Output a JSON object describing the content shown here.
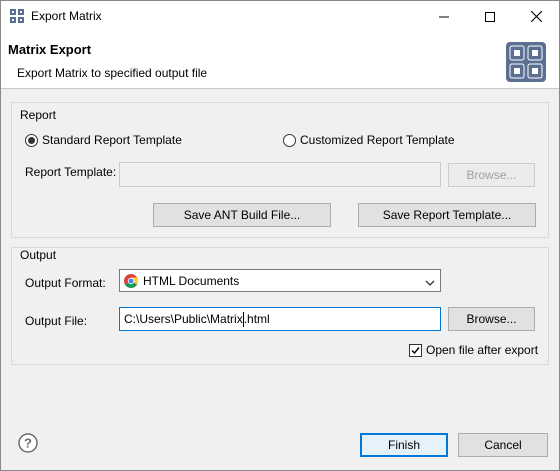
{
  "window": {
    "title": "Export Matrix"
  },
  "banner": {
    "title": "Matrix Export",
    "description": "Export Matrix to specified output file"
  },
  "report_group": {
    "label": "Report",
    "radio_standard": "Standard Report Template",
    "radio_custom": "Customized Report Template",
    "selected": "standard",
    "template_label": "Report Template:",
    "template_value": "",
    "browse_label": "Browse...",
    "save_ant_label": "Save ANT Build File...",
    "save_template_label": "Save Report Template..."
  },
  "output_group": {
    "label": "Output",
    "format_label": "Output Format:",
    "format_value": "HTML Documents",
    "file_label": "Output File:",
    "file_value_before_caret": "C:\\Users\\Public\\Matrix",
    "file_value_after_caret": ".html",
    "browse_label": "Browse...",
    "open_after_label": "Open file after export",
    "open_after_checked": true
  },
  "footer": {
    "finish_label": "Finish",
    "cancel_label": "Cancel"
  },
  "colors": {
    "accent": "#0078d7",
    "banner_icon": "#5b6f93"
  }
}
